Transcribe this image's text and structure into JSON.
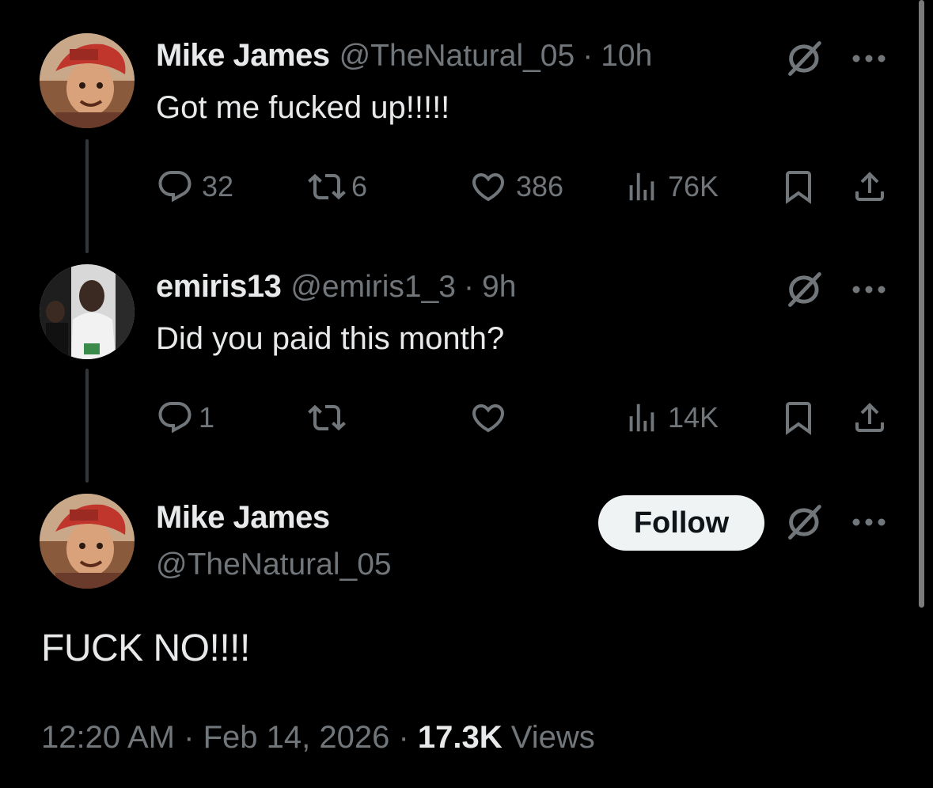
{
  "tweet1": {
    "name": "Mike James",
    "handle": "@TheNatural_05",
    "sep": "·",
    "time": "10h",
    "text": "Got me fucked up!!!!!",
    "replies": "32",
    "retweets": "6",
    "likes": "386",
    "views": "76K"
  },
  "tweet2": {
    "name": "emiris13",
    "handle": "@emiris1_3",
    "sep": "·",
    "time": "9h",
    "text": "Did you paid this month?",
    "replies": "1",
    "views": "14K"
  },
  "main": {
    "name": "Mike James",
    "handle": "@TheNatural_05",
    "follow_label": "Follow",
    "text": "FUCK NO!!!!",
    "time": "12:20 AM",
    "date": "Feb 14, 2026",
    "sep": "·",
    "views_count": "17.3K",
    "views_label": "Views"
  },
  "icons": {
    "reply": "reply-icon",
    "retweet": "retweet-icon",
    "like": "heart-icon",
    "views": "views-icon",
    "bookmark": "bookmark-icon",
    "share": "share-icon",
    "grok": "grok-icon",
    "more": "more-icon"
  },
  "colors": {
    "background": "#000000",
    "text": "#e7e9ea",
    "secondary": "#71767b",
    "follow_bg": "#eff3f4"
  }
}
